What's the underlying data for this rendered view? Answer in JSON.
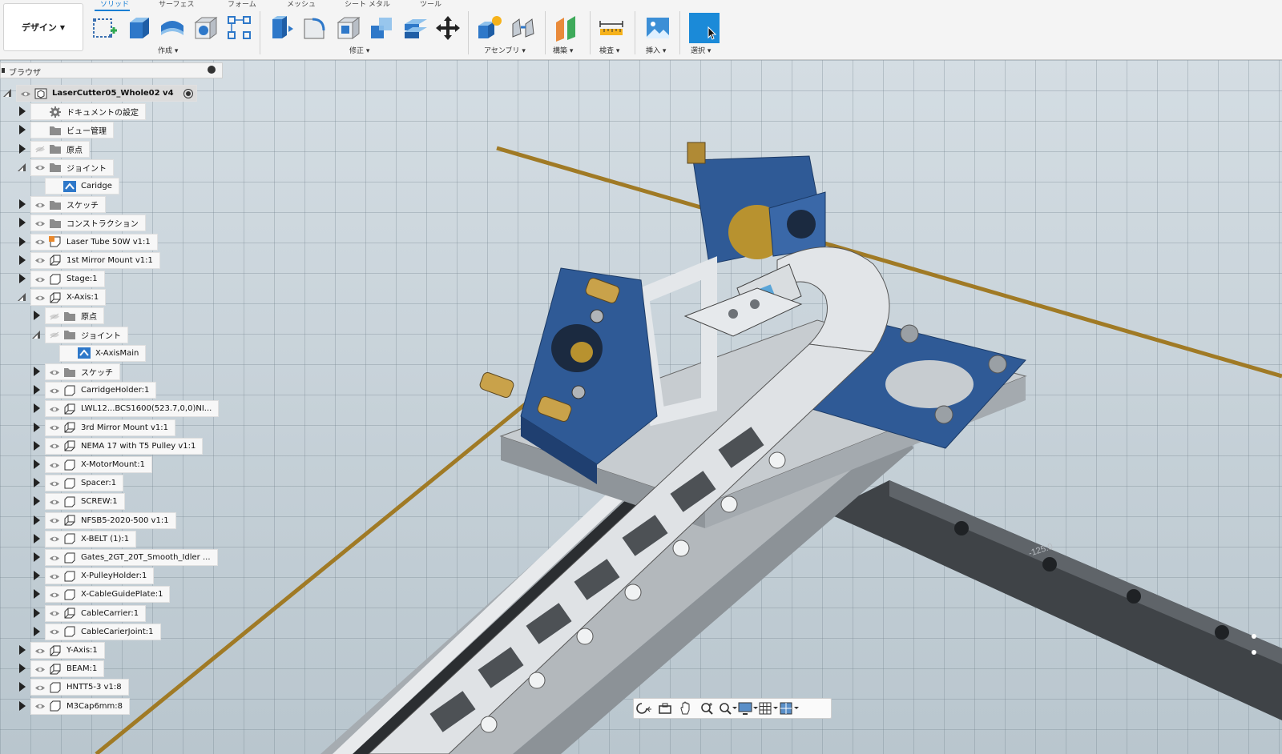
{
  "ribbon": {
    "workspace": "デザイン",
    "tabs": [
      {
        "label": "ソリッド",
        "active": true
      },
      {
        "label": "サーフェス",
        "active": false
      },
      {
        "label": "フォーム",
        "active": false
      },
      {
        "label": "メッシュ",
        "active": false
      },
      {
        "label": "シート メタル",
        "active": false
      },
      {
        "label": "ツール",
        "active": false
      }
    ],
    "groups": [
      "作成",
      "修正",
      "アセンブリ",
      "構築",
      "検査",
      "挿入",
      "選択"
    ],
    "colors": {
      "accent": "#1a7fd4",
      "select_tool": "#1b8ad8"
    }
  },
  "browser": {
    "title": "ブラウザ",
    "rows": [
      {
        "label": "LaserCutter05_Whole02 v4",
        "indent": 0,
        "toggle": "open",
        "icon": "assembly-icon",
        "eye": true,
        "root": true
      },
      {
        "label": "ドキュメントの設定",
        "indent": 1,
        "toggle": "closed",
        "icon": "gear-icon",
        "eye": false
      },
      {
        "label": "ビュー管理",
        "indent": 1,
        "toggle": "closed",
        "icon": "folder-icon",
        "eye": false
      },
      {
        "label": "原点",
        "indent": 1,
        "toggle": "closed",
        "icon": "folder-icon",
        "eye": true,
        "eye_off": true
      },
      {
        "label": "ジョイント",
        "indent": 1,
        "toggle": "open",
        "icon": "folder-icon",
        "eye": true
      },
      {
        "label": "Caridge",
        "indent": 2,
        "toggle": "none",
        "icon": "joint-icon",
        "eye": false
      },
      {
        "label": "スケッチ",
        "indent": 1,
        "toggle": "closed",
        "icon": "folder-icon",
        "eye": true
      },
      {
        "label": "コンストラクション",
        "indent": 1,
        "toggle": "closed",
        "icon": "folder-icon",
        "eye": true
      },
      {
        "label": "Laser Tube 50W v1:1",
        "indent": 1,
        "toggle": "closed",
        "icon": "component-linked-icon",
        "eye": true
      },
      {
        "label": "1st Mirror Mount v1:1",
        "indent": 1,
        "toggle": "closed",
        "icon": "component-icon",
        "eye": true
      },
      {
        "label": "Stage:1",
        "indent": 1,
        "toggle": "closed",
        "icon": "body-icon",
        "eye": true
      },
      {
        "label": "X-Axis:1",
        "indent": 1,
        "toggle": "open",
        "icon": "component-icon",
        "eye": true
      },
      {
        "label": "原点",
        "indent": 2,
        "toggle": "closed",
        "icon": "folder-icon",
        "eye": true,
        "eye_off": true
      },
      {
        "label": "ジョイント",
        "indent": 2,
        "toggle": "open",
        "icon": "folder-icon",
        "eye": true,
        "eye_off": true
      },
      {
        "label": "X-AxisMain",
        "indent": 3,
        "toggle": "none",
        "icon": "joint-icon",
        "eye": false
      },
      {
        "label": "スケッチ",
        "indent": 2,
        "toggle": "closed",
        "icon": "folder-icon",
        "eye": true
      },
      {
        "label": "CarridgeHolder:1",
        "indent": 2,
        "toggle": "closed",
        "icon": "body-icon",
        "eye": true
      },
      {
        "label": "LWL12...BCS1600(523.7,0,0)NI...",
        "indent": 2,
        "toggle": "closed",
        "icon": "component-icon",
        "eye": true
      },
      {
        "label": "3rd Mirror Mount v1:1",
        "indent": 2,
        "toggle": "closed",
        "icon": "component-icon",
        "eye": true
      },
      {
        "label": "NEMA 17 with T5 Pulley v1:1",
        "indent": 2,
        "toggle": "closed",
        "icon": "component-icon",
        "eye": true
      },
      {
        "label": "X-MotorMount:1",
        "indent": 2,
        "toggle": "closed",
        "icon": "body-icon",
        "eye": true
      },
      {
        "label": "Spacer:1",
        "indent": 2,
        "toggle": "closed",
        "icon": "body-icon",
        "eye": true
      },
      {
        "label": "SCREW:1",
        "indent": 2,
        "toggle": "closed",
        "icon": "body-icon",
        "eye": true
      },
      {
        "label": "NFSB5-2020-500 v1:1",
        "indent": 2,
        "toggle": "closed",
        "icon": "component-icon",
        "eye": true
      },
      {
        "label": "X-BELT (1):1",
        "indent": 2,
        "toggle": "closed",
        "icon": "body-icon",
        "eye": true
      },
      {
        "label": "Gates_2GT_20T_Smooth_Idler ...",
        "indent": 2,
        "toggle": "closed",
        "icon": "body-icon",
        "eye": true
      },
      {
        "label": "X-PulleyHolder:1",
        "indent": 2,
        "toggle": "closed",
        "icon": "body-icon",
        "eye": true
      },
      {
        "label": "X-CableGuidePlate:1",
        "indent": 2,
        "toggle": "closed",
        "icon": "body-icon",
        "eye": true
      },
      {
        "label": "CableCarrier:1",
        "indent": 2,
        "toggle": "closed",
        "icon": "component-icon",
        "eye": true
      },
      {
        "label": "CableCarierJoint:1",
        "indent": 2,
        "toggle": "closed",
        "icon": "body-icon",
        "eye": true
      },
      {
        "label": "Y-Axis:1",
        "indent": 1,
        "toggle": "closed",
        "icon": "component-icon",
        "eye": true
      },
      {
        "label": "BEAM:1",
        "indent": 1,
        "toggle": "closed",
        "icon": "component-icon",
        "eye": true
      },
      {
        "label": "HNTT5-3 v1:8",
        "indent": 1,
        "toggle": "closed",
        "icon": "body-icon",
        "eye": true
      },
      {
        "label": "M3Cap6mm:8",
        "indent": 1,
        "toggle": "closed",
        "icon": "body-icon",
        "eye": true
      }
    ]
  },
  "viewport": {
    "rail_label": "-125.0",
    "colors": {
      "anodized_blue": "#2f5a96",
      "brass": "#c9a24a",
      "rod": "#b48a2c",
      "grid": "#cfd9df"
    }
  },
  "navbar": {
    "icons": [
      "orbit-icon",
      "look-at-icon",
      "pan-icon",
      "zoom-icon",
      "zoom-window-icon",
      "display-settings-icon",
      "grid-settings-icon",
      "viewports-icon"
    ]
  }
}
